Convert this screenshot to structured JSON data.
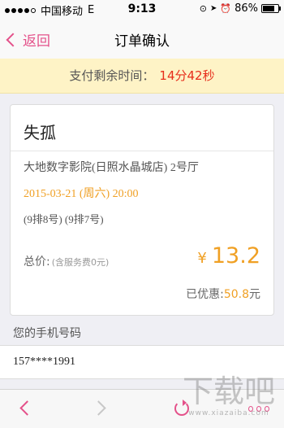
{
  "status_bar": {
    "carrier": "中国移动",
    "network": "E",
    "time": "9:13",
    "battery_percent": "86%",
    "battery_level": 0.86,
    "signal_bars": 4
  },
  "nav": {
    "back_label": "返回",
    "title": "订单确认"
  },
  "countdown": {
    "label": "支付剩余时间：",
    "time_left": "14分42秒"
  },
  "order": {
    "movie_title": "失孤",
    "cinema": "大地数字影院(日照水晶城店) 2号厅",
    "showtime": "2015-03-21 (周六) 20:00",
    "seats": "(9排8号) (9排7号)",
    "total_label": "总价:",
    "total_note": "(含服务费0元)",
    "currency": "¥",
    "price": "13.2",
    "discount_label": "已优惠:",
    "discount_value": "50.8",
    "discount_unit": "元"
  },
  "phone": {
    "label": "您的手机号码",
    "value": "157****1991"
  },
  "toolbar": {
    "icons": [
      "back-icon",
      "forward-icon",
      "refresh-icon",
      "more-icon"
    ]
  },
  "watermark": {
    "main": "下载吧",
    "sub": "www.xiazaiba.com"
  },
  "colors": {
    "accent_pink": "#e4518a",
    "price_orange": "#f0a024",
    "countdown_red": "#e72e1b",
    "banner_yellow": "#fef3c6"
  }
}
